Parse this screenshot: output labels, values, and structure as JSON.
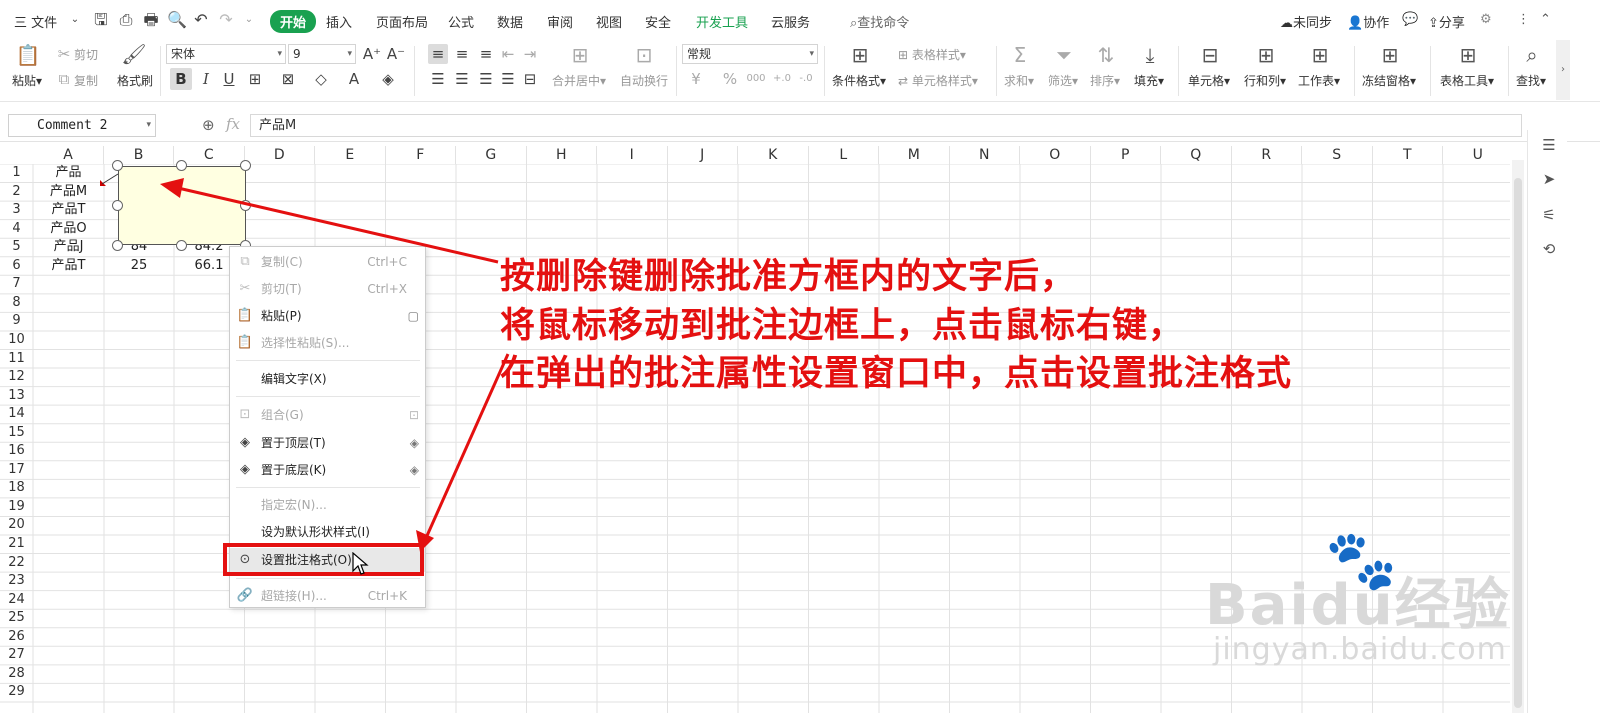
{
  "menubar": {
    "file": "三 文件",
    "tabs": [
      "开始",
      "插入",
      "页面布局",
      "公式",
      "数据",
      "审阅",
      "视图",
      "安全",
      "开发工具",
      "云服务"
    ],
    "search": "查找命令",
    "sync": "未同步",
    "collab": "协作",
    "share": "分享"
  },
  "ribbon": {
    "paste": "粘贴",
    "cut": "剪切",
    "copy": "复制",
    "format_painter": "格式刷",
    "font_name": "宋体",
    "font_size": "9",
    "number_format": "常规",
    "merge_center": "合并居中",
    "wrap_text": "自动换行",
    "cond_format": "条件格式",
    "table_style": "表格样式",
    "cell_style": "单元格样式",
    "sum": "求和",
    "filter": "筛选",
    "sort": "排序",
    "fill": "填充",
    "cell": "单元格",
    "row_col": "行和列",
    "worksheet": "工作表",
    "freeze": "冻结窗格",
    "table_tools": "表格工具",
    "find": "查找"
  },
  "formula_bar": {
    "name_box": "Comment 2",
    "fx": "fx",
    "value": "产品M"
  },
  "grid": {
    "columns": [
      "A",
      "B",
      "C",
      "D",
      "E",
      "F",
      "G",
      "H",
      "I",
      "J",
      "K",
      "L",
      "M",
      "N",
      "O",
      "P",
      "Q",
      "R",
      "S",
      "T",
      "U"
    ],
    "rows": [
      "1",
      "2",
      "3",
      "4",
      "5",
      "6",
      "7",
      "8",
      "9",
      "10",
      "11",
      "12",
      "13",
      "14",
      "15",
      "16",
      "17",
      "18",
      "19",
      "20",
      "21",
      "22",
      "23",
      "24",
      "25",
      "26",
      "27",
      "28",
      "29"
    ],
    "a_col": [
      "产品",
      "产品M",
      "产品T",
      "产品O",
      "产品J",
      "产品T"
    ],
    "b5": "84",
    "c5": "84.2",
    "b6": "25",
    "c6": "66.1"
  },
  "context_menu": {
    "items": [
      {
        "label": "复制(C)",
        "shortcut": "Ctrl+C"
      },
      {
        "label": "剪切(T)",
        "shortcut": "Ctrl+X"
      },
      {
        "label": "粘贴(P)",
        "shortcut": ""
      },
      {
        "label": "选择性粘贴(S)...",
        "shortcut": ""
      },
      {
        "label": "编辑文字(X)",
        "shortcut": ""
      },
      {
        "label": "组合(G)",
        "shortcut": ""
      },
      {
        "label": "置于顶层(T)",
        "shortcut": ""
      },
      {
        "label": "置于底层(K)",
        "shortcut": ""
      },
      {
        "label": "指定宏(N)...",
        "shortcut": ""
      },
      {
        "label": "设为默认形状样式(I)",
        "shortcut": ""
      },
      {
        "label": "设置批注格式(O)...",
        "shortcut": ""
      },
      {
        "label": "超链接(H)...",
        "shortcut": "Ctrl+K"
      }
    ]
  },
  "annotation": {
    "line1": "按删除键删除批准方框内的文字后，",
    "line2": "将鼠标移动到批注边框上，点击鼠标右键，",
    "line3": "在弹出的批注属性设置窗口中，点击设置批注格式",
    "color": "#e41010"
  },
  "watermark": {
    "brand": "Bai",
    "brand2": "du",
    "cn": "经验",
    "url": "jingyan.baidu.com"
  }
}
